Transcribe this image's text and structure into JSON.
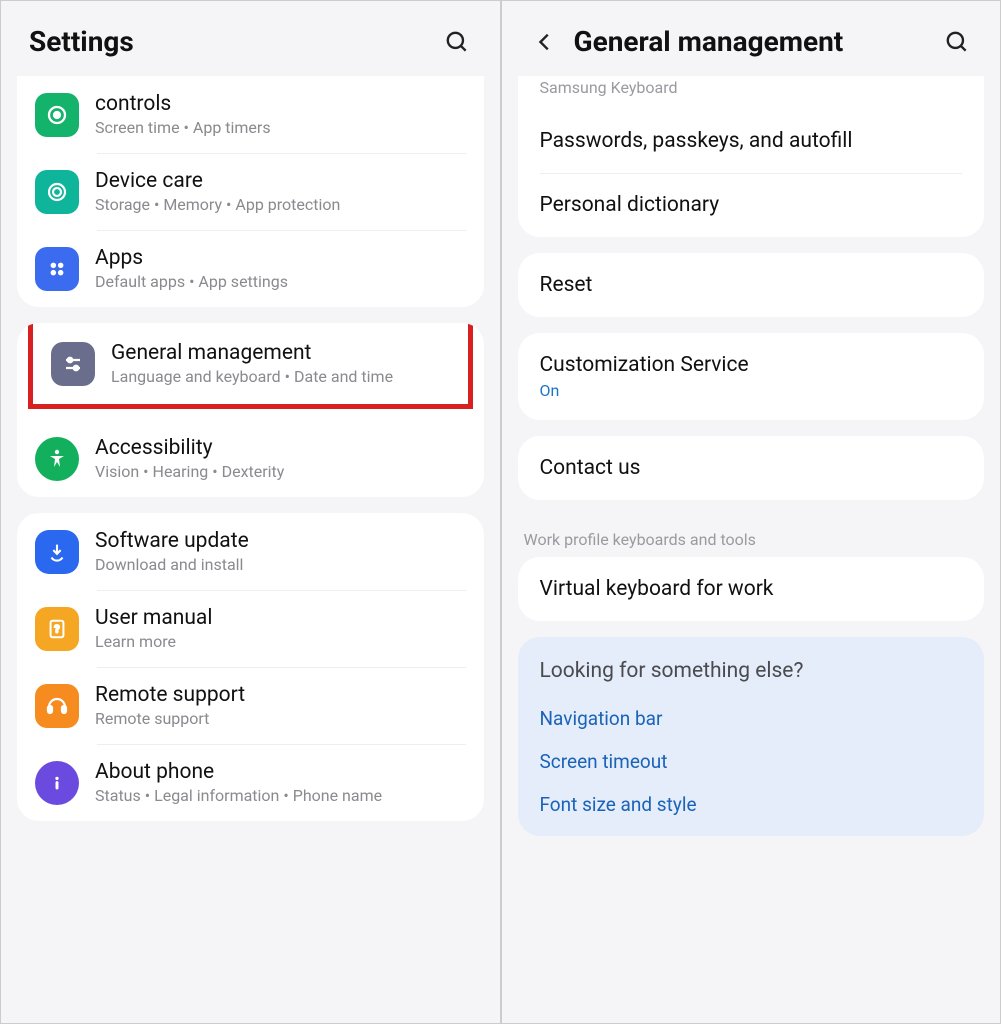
{
  "left": {
    "title": "Settings",
    "group1": [
      {
        "title": "controls",
        "sub": "Screen time • App timers",
        "iconColor": "green"
      },
      {
        "title": "Device care",
        "sub": "Storage • Memory • App protection",
        "iconColor": "teal"
      },
      {
        "title": "Apps",
        "sub": "Default apps • App settings",
        "iconColor": "blue"
      }
    ],
    "highlighted": {
      "title": "General management",
      "sub": "Language and keyboard • Date and time",
      "iconColor": "slate"
    },
    "group2_after": [
      {
        "title": "Accessibility",
        "sub": "Vision • Hearing • Dexterity",
        "iconColor": "access"
      }
    ],
    "group3": [
      {
        "title": "Software update",
        "sub": "Download and install",
        "iconColor": "update"
      },
      {
        "title": "User manual",
        "sub": "Learn more",
        "iconColor": "amber"
      },
      {
        "title": "Remote support",
        "sub": "Remote support",
        "iconColor": "orange"
      },
      {
        "title": "About phone",
        "sub": "Status • Legal information • Phone name",
        "iconColor": "violet"
      }
    ]
  },
  "right": {
    "title": "General management",
    "partialTop": "Samsung Keyboard",
    "card1": [
      {
        "title": "Passwords, passkeys, and autofill"
      },
      {
        "title": "Personal dictionary"
      }
    ],
    "resetCard": {
      "title": "Reset"
    },
    "customCard": {
      "title": "Customization Service",
      "sub": "On"
    },
    "contactCard": {
      "title": "Contact us"
    },
    "workHeader": "Work profile keyboards and tools",
    "workCard": {
      "title": "Virtual keyboard for work"
    },
    "looking": {
      "heading": "Looking for something else?",
      "links": [
        "Navigation bar",
        "Screen timeout",
        "Font size and style"
      ]
    }
  }
}
